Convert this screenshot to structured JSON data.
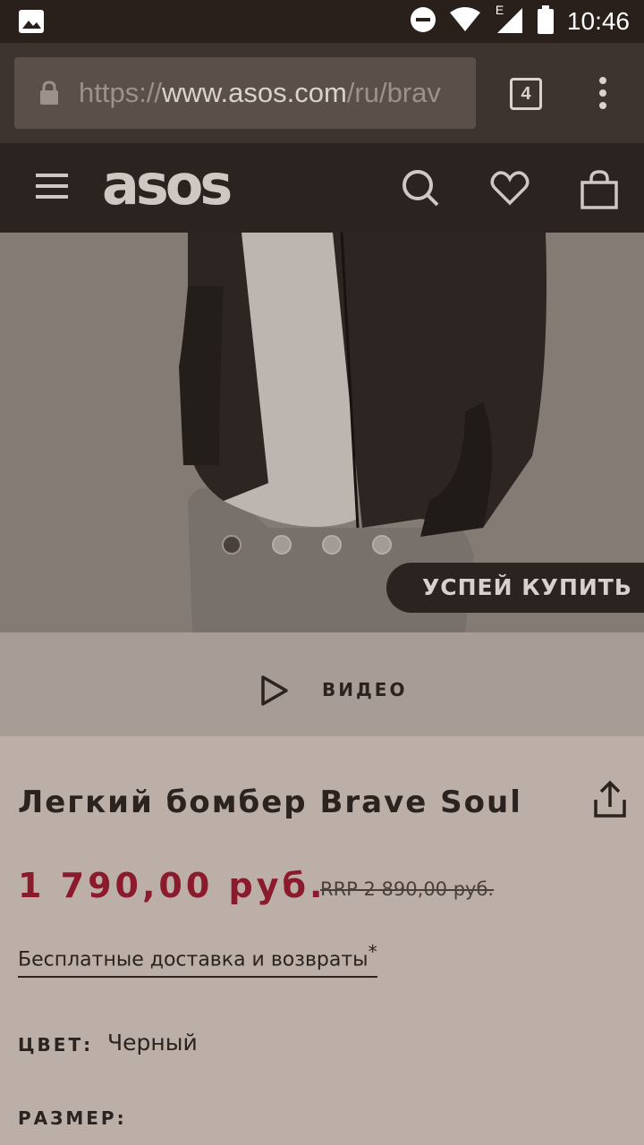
{
  "status_bar": {
    "time": "10:46",
    "network_type": "E",
    "icons": [
      "image-icon",
      "do-not-disturb-icon",
      "wifi-icon",
      "signal-icon",
      "battery-icon"
    ]
  },
  "browser": {
    "url_scheme": "https://",
    "url_host": "www.asos.com",
    "url_path": "/ru/brav",
    "tab_count": "4"
  },
  "header": {
    "logo": "asos",
    "icons": [
      "menu-icon",
      "search-icon",
      "heart-icon",
      "bag-icon"
    ]
  },
  "hero": {
    "carousel_count": 4,
    "active_index": 0,
    "badge": "УСПЕЙ КУПИТЬ"
  },
  "video": {
    "label": "ВИДЕО"
  },
  "product": {
    "title": "Легкий бомбер Brave Soul",
    "price": "1 790,00 руб.",
    "rrp": "RRP 2 890,00 руб.",
    "delivery": "Бесплатные доставка и возвраты",
    "delivery_mark": "*",
    "color_label": "ЦВЕТ:",
    "color_value": "Черный",
    "size_label": "РАЗМЕР:"
  },
  "colors": {
    "header_bg": "#2b231f",
    "price_red": "#8a1a2c",
    "page_bg": "#bbafa8"
  }
}
